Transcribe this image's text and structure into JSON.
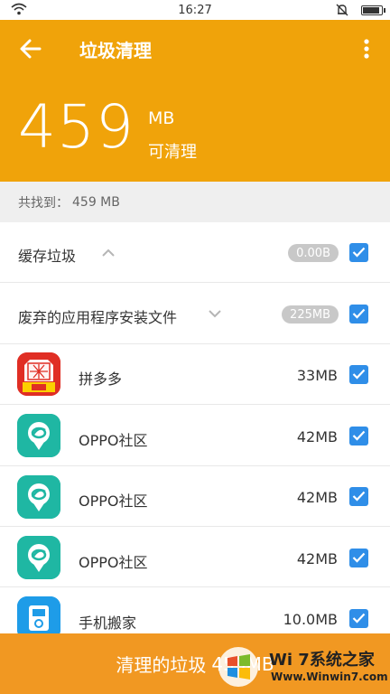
{
  "status_bar": {
    "time": "16:27"
  },
  "header": {
    "title": "垃圾清理",
    "size_value": "459",
    "size_unit": "MB",
    "size_caption": "可清理"
  },
  "found": {
    "label": "共找到：",
    "value": "459 MB"
  },
  "categories": [
    {
      "label": "缓存垃圾",
      "size": "0.00B",
      "checked": true,
      "chevron": "up"
    },
    {
      "label": "废弃的应用程序安装文件",
      "size": "225MB",
      "checked": true,
      "chevron": "down"
    }
  ],
  "apps": [
    {
      "name": "拼多多",
      "size": "33MB",
      "icon": "pinduoduo-icon",
      "checked": true
    },
    {
      "name": "OPPO社区",
      "size": "42MB",
      "icon": "oppo-community-icon",
      "checked": true
    },
    {
      "name": "OPPO社区",
      "size": "42MB",
      "icon": "oppo-community-icon",
      "checked": true
    },
    {
      "name": "OPPO社区",
      "size": "42MB",
      "icon": "oppo-community-icon",
      "checked": true
    },
    {
      "name": "手机搬家",
      "size": "10.0MB",
      "icon": "phone-clone-icon",
      "checked": true
    }
  ],
  "clean_button": {
    "label": "清理的垃圾",
    "value": "459MB"
  },
  "watermark": {
    "title": "Wi 7系统之家",
    "url": "Www.Winwin7.com"
  },
  "colors": {
    "header_bg": "#f0a30a",
    "button_bg": "#f19822",
    "checkbox": "#2f8ee8"
  }
}
